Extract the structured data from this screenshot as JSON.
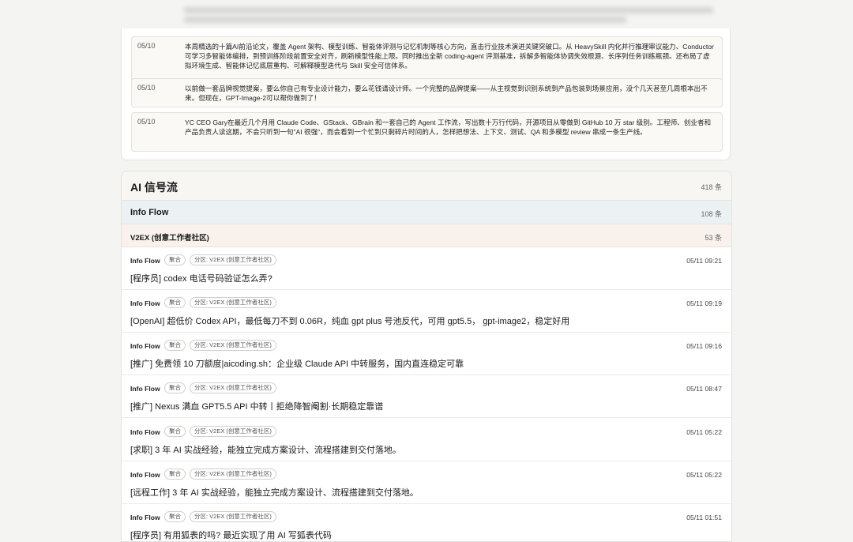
{
  "top_news": [
    {
      "date": "05/10",
      "text": "本周精选的十篇AI前沿论文，覆盖 Agent 架构、模型训练、智能体评测与记忆机制等核心方向，直击行业技术演进关键突破口。从 HeavySkill 内化并行推理审议能力、Conductor 可学习多智能体编排，到预训练阶段前置安全对齐，刷新模型性能上限。同时推出全新 coding-agent 评测基准，拆解多智能体协调失效根源、长序列任务训练瓶颈。还布局了虚拟环境生成、智能体记忆底层重构、可解释模型迭代与 Skill 安全可信体系。"
    },
    {
      "date": "05/10",
      "text": "以前做一套品牌视觉提案，要么你自己有专业设计能力，要么花钱请设计师。一个完整的品牌提案——从主视觉到识别系统到产品包装到场景应用，没个几天甚至几周根本出不来。但现在，GPT-Image-2可以帮你做到了！"
    },
    {
      "date": "05/10",
      "text": "YC CEO Gary在最近几个月用 Claude Code、GStack、GBrain 和一套自己的 Agent 工作流，写出数十万行代码，开源项目从零做到 GitHub 10 万 star 级别。工程师、创业者和产品负责人读这期，不会只听到一句\"AI 很强\"，而会看到一个忙到只剩碎片时间的人，怎样把想法、上下文、测试、QA 和多模型 review 串成一条生产线。"
    }
  ],
  "section": {
    "title": "AI 信号流",
    "count": "418 条"
  },
  "subsection": {
    "title": "Info Flow",
    "count": "108 条"
  },
  "source": {
    "title": "V2EX (创意工作者社区)",
    "count": "53 条"
  },
  "feed": [
    {
      "source": "Info Flow",
      "tag1": "聚合",
      "tag2": "分区: V2EX (创意工作者社区)",
      "time": "05/11 09:21",
      "title": "[程序员] codex 电话号码验证怎么弄?"
    },
    {
      "source": "Info Flow",
      "tag1": "聚合",
      "tag2": "分区: V2EX (创意工作者社区)",
      "time": "05/11 09:19",
      "title": "[OpenAI] 超低价 Codex API，最低每刀不到 0.06R，纯血 gpt plus 号池反代，可用 gpt5.5， gpt-image2，稳定好用"
    },
    {
      "source": "Info Flow",
      "tag1": "聚合",
      "tag2": "分区: V2EX (创意工作者社区)",
      "time": "05/11 09:16",
      "title": "[推广] 免费领 10 刀额度|aicoding.sh：企业级 Claude API 中转服务，国内直连稳定可靠"
    },
    {
      "source": "Info Flow",
      "tag1": "聚合",
      "tag2": "分区: V2EX (创意工作者社区)",
      "time": "05/11 08:47",
      "title": "[推广] Nexus 满血 GPT5.5 API 中转丨拒绝降智阉割·长期稳定靠谱"
    },
    {
      "source": "Info Flow",
      "tag1": "聚合",
      "tag2": "分区: V2EX (创意工作者社区)",
      "time": "05/11 05:22",
      "title": "[求职] 3 年 AI 实战经验，能独立完成方案设计、流程搭建到交付落地。"
    },
    {
      "source": "Info Flow",
      "tag1": "聚合",
      "tag2": "分区: V2EX (创意工作者社区)",
      "time": "05/11 05:22",
      "title": "[远程工作] 3 年 AI 实战经验，能独立完成方案设计、流程搭建到交付落地。"
    },
    {
      "source": "Info Flow",
      "tag1": "聚合",
      "tag2": "分区: V2EX (创意工作者社区)",
      "time": "05/11 01:51",
      "title": "[程序员] 有用狐表的吗? 最近实现了用 AI 写狐表代码"
    }
  ]
}
